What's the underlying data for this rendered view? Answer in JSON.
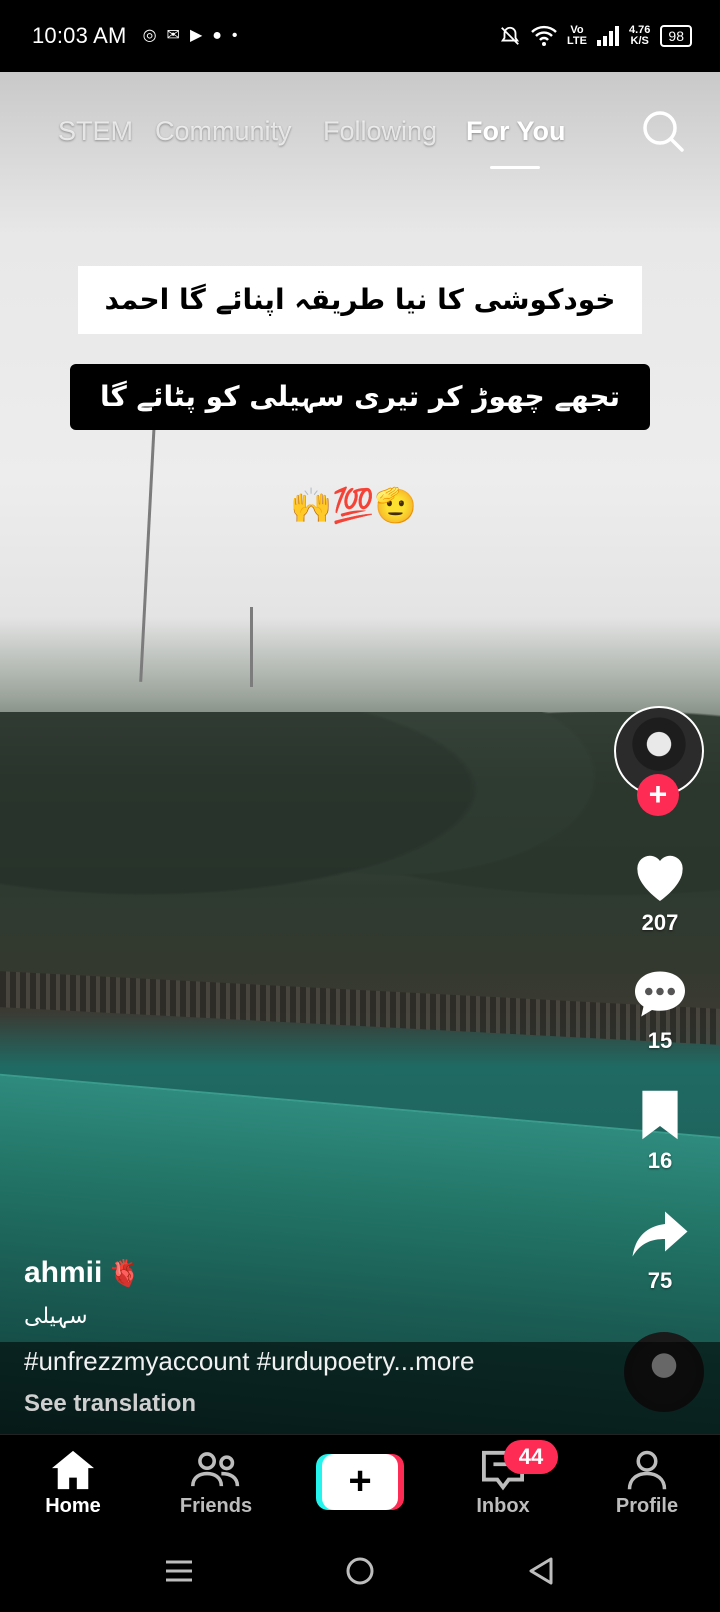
{
  "status_bar": {
    "time": "10:03 AM",
    "left_icons": [
      "aperture-icon",
      "gmail-icon",
      "youtube-icon",
      "chat-icon",
      "dot-icon"
    ],
    "net_top": "Vo",
    "net_bottom": "LTE",
    "speed_top": "4.76",
    "speed_bottom": "K/S",
    "battery": "98"
  },
  "top_tabs": {
    "items": [
      "STEM",
      "Community",
      "Following",
      "For You"
    ],
    "active": "For You"
  },
  "video": {
    "caption_line1": "خودکوشی کا نیا طریقہ اپنائے گا احمد",
    "caption_line2": "تجھے چھوڑ کر تیری سہیلی کو پٹائے گا",
    "emoji_line": "🙌💯🫡"
  },
  "right_rail": {
    "likes": "207",
    "comments": "15",
    "saves": "16",
    "shares": "75"
  },
  "post": {
    "username": "ahmii",
    "username_emoji": "🫀",
    "description": "سہیلی",
    "hashtags": "#unfrezzmyaccount #urdupoetry...more",
    "see_translation": "See translation"
  },
  "bottom_nav": {
    "home": "Home",
    "friends": "Friends",
    "create": "+",
    "inbox": "Inbox",
    "inbox_badge": "44",
    "profile": "Profile"
  },
  "colors": {
    "accent_red": "#fe2c55",
    "accent_cyan": "#25f4ee"
  }
}
